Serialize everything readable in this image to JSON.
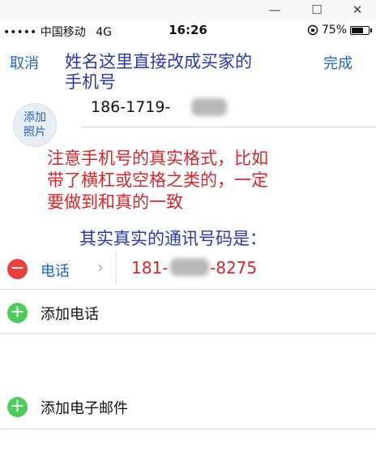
{
  "window": {
    "minimize": "—",
    "maximize": "☐",
    "close": "✕"
  },
  "status_bar": {
    "carrier": "••••• 中国移动",
    "network": "4G",
    "time": "16:26",
    "battery": "75%",
    "battery_level": 0.75
  },
  "nav": {
    "cancel": "取消",
    "done": "完成"
  },
  "annotation_top": {
    "line1": "姓名这里直接改成买家的",
    "line2": "手机号"
  },
  "contact": {
    "photo_line1": "添加",
    "photo_line2": "照片",
    "name_value": "186-1719-"
  },
  "annotation_red": {
    "line1": "注意手机号的真实格式，比如",
    "line2": "带了横杠或空格之类的，一定",
    "line3": "要做到和真的一致"
  },
  "annotation_mid": "其实真实的通讯号码是：",
  "phone_row": {
    "label": "电话",
    "chevron": "›",
    "number_start": "181-",
    "number_end": "-8275",
    "remove": "−"
  },
  "add_phone": {
    "icon": "+",
    "label": "添加电话"
  },
  "add_email": {
    "icon": "+",
    "label": "添加电子邮件"
  },
  "colors": {
    "ios_blue": "#1e64c8",
    "annotation_red": "#d9262c",
    "annotation_blue": "#2b3aa8",
    "delete_red": "#e8413c",
    "add_green": "#4dcc5a"
  }
}
